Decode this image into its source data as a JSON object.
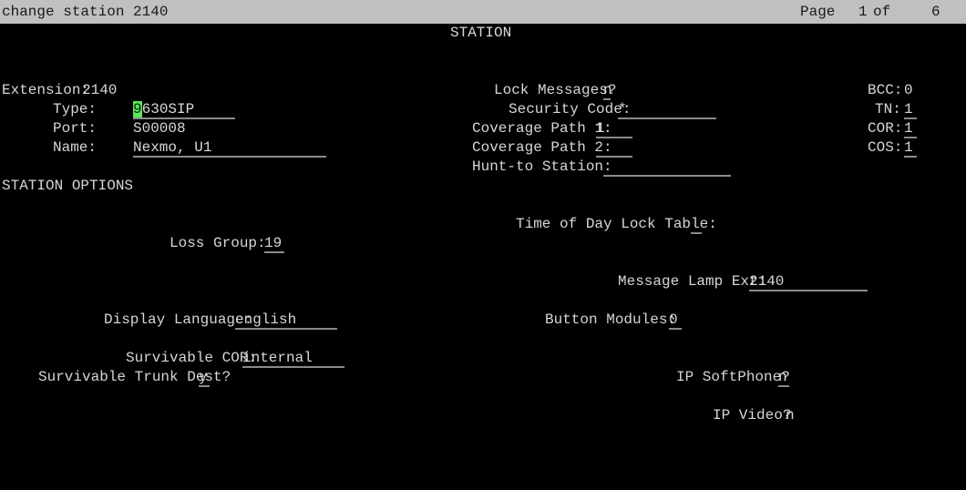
{
  "titlebar": {
    "command": "change station 2140",
    "page_label": "Page",
    "page_current": "1",
    "page_of": "of",
    "page_total": "6"
  },
  "form": {
    "title": "STATION",
    "section_heading": "STATION OPTIONS",
    "colors": {
      "titlebar_background": "#c0c0c0",
      "terminal_background": "#000000",
      "text": "#d8d8d8",
      "field_underline": "#8a8a8a",
      "cursor_background": "#5be55b",
      "cursor_text": "#062806"
    },
    "cursor": {
      "field": "type",
      "character": "9"
    },
    "fields": {
      "extension": {
        "label": "Extension:",
        "value": "2140"
      },
      "type": {
        "label": "Type:",
        "value_head": "9",
        "value_tail": "630SIP"
      },
      "port": {
        "label": "Port:",
        "value": "S00008"
      },
      "name": {
        "label": "Name:",
        "value": "Nexmo, U1"
      },
      "lock_messages": {
        "label": "Lock Messages?",
        "value": "n"
      },
      "security_code": {
        "label": "Security Code:",
        "value": "*"
      },
      "coverage_path_1": {
        "label": "Coverage Path 1:",
        "value": "1"
      },
      "coverage_path_2": {
        "label": "Coverage Path 2:",
        "value": ""
      },
      "hunt_to_station": {
        "label": "Hunt-to Station:",
        "value": ""
      },
      "bcc": {
        "label": "BCC:",
        "value": "0"
      },
      "tn": {
        "label": "TN:",
        "value": "1"
      },
      "cor": {
        "label": "COR:",
        "value": "1"
      },
      "cos": {
        "label": "COS:",
        "value": "1"
      },
      "time_of_day_lock_table": {
        "label": "Time of Day Lock Table:",
        "value": ""
      },
      "loss_group": {
        "label": "Loss Group:",
        "value": "19"
      },
      "message_lamp_ext": {
        "label": "Message Lamp Ext:",
        "value": "2140"
      },
      "display_language": {
        "label": "Display Language:",
        "value": "english"
      },
      "button_modules": {
        "label": "Button Modules:",
        "value": "0"
      },
      "survivable_cor": {
        "label": "Survivable COR:",
        "value": "internal"
      },
      "survivable_trunk_dest": {
        "label": "Survivable Trunk Dest?",
        "value": "y"
      },
      "ip_softphone": {
        "label": "IP SoftPhone?",
        "value": "n"
      },
      "ip_video": {
        "label": "IP Video?",
        "value": "n"
      }
    }
  }
}
